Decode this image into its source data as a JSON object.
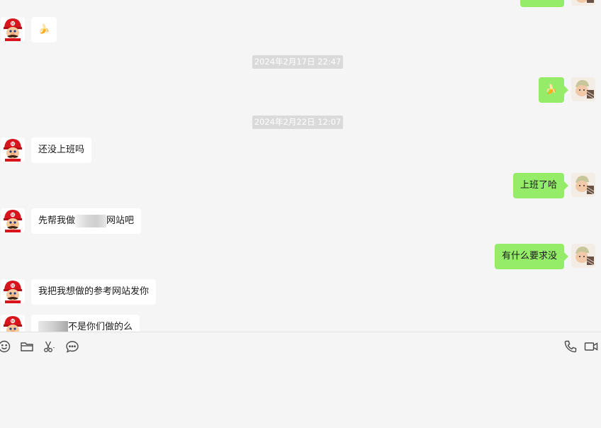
{
  "messages": {
    "m1": {
      "text": "🍌"
    },
    "ts1": "2024年2月17日 22:47",
    "m2": {
      "text": "🍌"
    },
    "ts2": "2024年2月22日 12:07",
    "m3": {
      "text": "还没上班吗"
    },
    "m4": {
      "text": "上班了哈"
    },
    "m5": {
      "before": "先帮我做",
      "after": "网站吧"
    },
    "m6": {
      "text": "有什么要求没"
    },
    "m7": {
      "text": "我把我想做的参考网站发你"
    },
    "m8": {
      "after": "不是你们做的么"
    }
  },
  "colors": {
    "outgoing_bubble": "#95ec69",
    "incoming_bubble": "#ffffff",
    "background": "#f5f5f5"
  },
  "toolbar": {
    "left_icons": [
      "emoji-icon",
      "folder-icon",
      "scissors-icon",
      "chat-history-icon"
    ],
    "right_icons": [
      "phone-icon",
      "video-call-icon"
    ]
  }
}
